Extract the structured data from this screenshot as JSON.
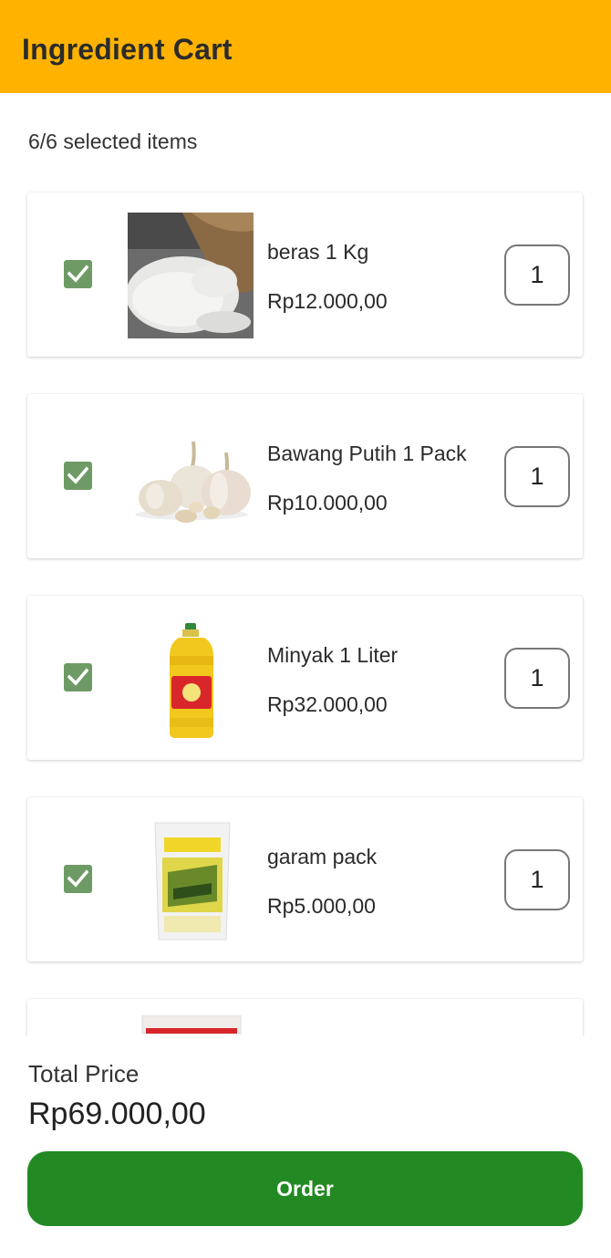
{
  "header": {
    "title": "Ingredient Cart",
    "color": "#FFB300"
  },
  "cart": {
    "selected_label": "6/6 selected items",
    "items": [
      {
        "name": "beras 1 Kg",
        "price": "Rp12.000,00",
        "qty": "1",
        "checked": true,
        "image": "rice-image"
      },
      {
        "name": "Bawang Putih 1 Pack",
        "price": "Rp10.000,00",
        "qty": "1",
        "checked": true,
        "image": "garlic-image"
      },
      {
        "name": "Minyak 1 Liter",
        "price": "Rp32.000,00",
        "qty": "1",
        "checked": true,
        "image": "cooking-oil-image"
      },
      {
        "name": "garam pack",
        "price": "Rp5.000,00",
        "qty": "1",
        "checked": true,
        "image": "salt-pack-image"
      }
    ]
  },
  "footer": {
    "total_label": "Total Price",
    "total_value": "Rp69.000,00",
    "order_label": "Order",
    "order_color": "#238A23"
  }
}
